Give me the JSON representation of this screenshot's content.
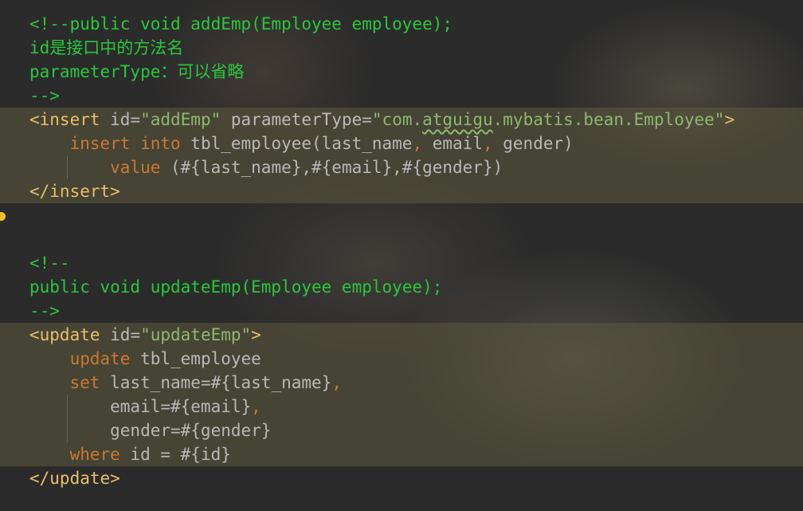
{
  "lines": [
    {
      "parts": [
        {
          "text": "<!--public void addEmp(Employee employee);",
          "cls": "c"
        }
      ]
    },
    {
      "parts": [
        {
          "text": "id是接口中的方法名",
          "cls": "c"
        }
      ]
    },
    {
      "parts": [
        {
          "text": "parameterType：可以省略",
          "cls": "c"
        }
      ]
    },
    {
      "parts": [
        {
          "text": "-->",
          "cls": "c"
        }
      ]
    },
    {
      "parts": [
        {
          "text": "<insert",
          "cls": "t"
        },
        {
          "text": " id=",
          "cls": "a"
        },
        {
          "text": "\"addEmp\"",
          "cls": "s"
        },
        {
          "text": " parameterType=",
          "cls": "a"
        },
        {
          "text": "\"com.",
          "cls": "s"
        },
        {
          "text": "atguigu",
          "cls": "s squig"
        },
        {
          "text": ".mybatis.bean.Employee\"",
          "cls": "s"
        },
        {
          "text": ">",
          "cls": "t"
        }
      ]
    },
    {
      "parts": [
        {
          "text": "    ",
          "cls": "p"
        },
        {
          "text": "insert into",
          "cls": "k"
        },
        {
          "text": " tbl_employee(last_name",
          "cls": "p"
        },
        {
          "text": ",",
          "cls": "k"
        },
        {
          "text": " email",
          "cls": "p"
        },
        {
          "text": ",",
          "cls": "k"
        },
        {
          "text": " gender)",
          "cls": "p"
        }
      ]
    },
    {
      "parts": [
        {
          "text": "        ",
          "cls": "p"
        },
        {
          "text": "value",
          "cls": "k"
        },
        {
          "text": " (#{last_name},#{email},#{gender})",
          "cls": "p"
        }
      ]
    },
    {
      "parts": [
        {
          "text": "</insert>",
          "cls": "t"
        }
      ]
    },
    {
      "parts": [
        {
          "text": "",
          "cls": "p"
        }
      ]
    },
    {
      "parts": [
        {
          "text": "",
          "cls": "p"
        }
      ]
    },
    {
      "parts": [
        {
          "text": "<!--",
          "cls": "c"
        }
      ]
    },
    {
      "parts": [
        {
          "text": "public void updateEmp(Employee employee);",
          "cls": "c"
        }
      ]
    },
    {
      "parts": [
        {
          "text": "-->",
          "cls": "c"
        }
      ]
    },
    {
      "parts": [
        {
          "text": "<update",
          "cls": "t"
        },
        {
          "text": " id=",
          "cls": "a"
        },
        {
          "text": "\"updateEmp\"",
          "cls": "s"
        },
        {
          "text": ">",
          "cls": "t"
        }
      ]
    },
    {
      "parts": [
        {
          "text": "    ",
          "cls": "p"
        },
        {
          "text": "update",
          "cls": "k"
        },
        {
          "text": " tbl_employee",
          "cls": "p"
        }
      ]
    },
    {
      "parts": [
        {
          "text": "    ",
          "cls": "p"
        },
        {
          "text": "set",
          "cls": "k"
        },
        {
          "text": " last_name=#{last_name}",
          "cls": "p"
        },
        {
          "text": ",",
          "cls": "k"
        }
      ]
    },
    {
      "parts": [
        {
          "text": "        email=#{email}",
          "cls": "p"
        },
        {
          "text": ",",
          "cls": "k"
        }
      ]
    },
    {
      "parts": [
        {
          "text": "        gender=#{gender}",
          "cls": "p"
        }
      ]
    },
    {
      "parts": [
        {
          "text": "    ",
          "cls": "p"
        },
        {
          "text": "where",
          "cls": "k"
        },
        {
          "text": " id = #{id}",
          "cls": "p"
        }
      ]
    },
    {
      "parts": [
        {
          "text": "</update>",
          "cls": "t"
        }
      ]
    }
  ]
}
